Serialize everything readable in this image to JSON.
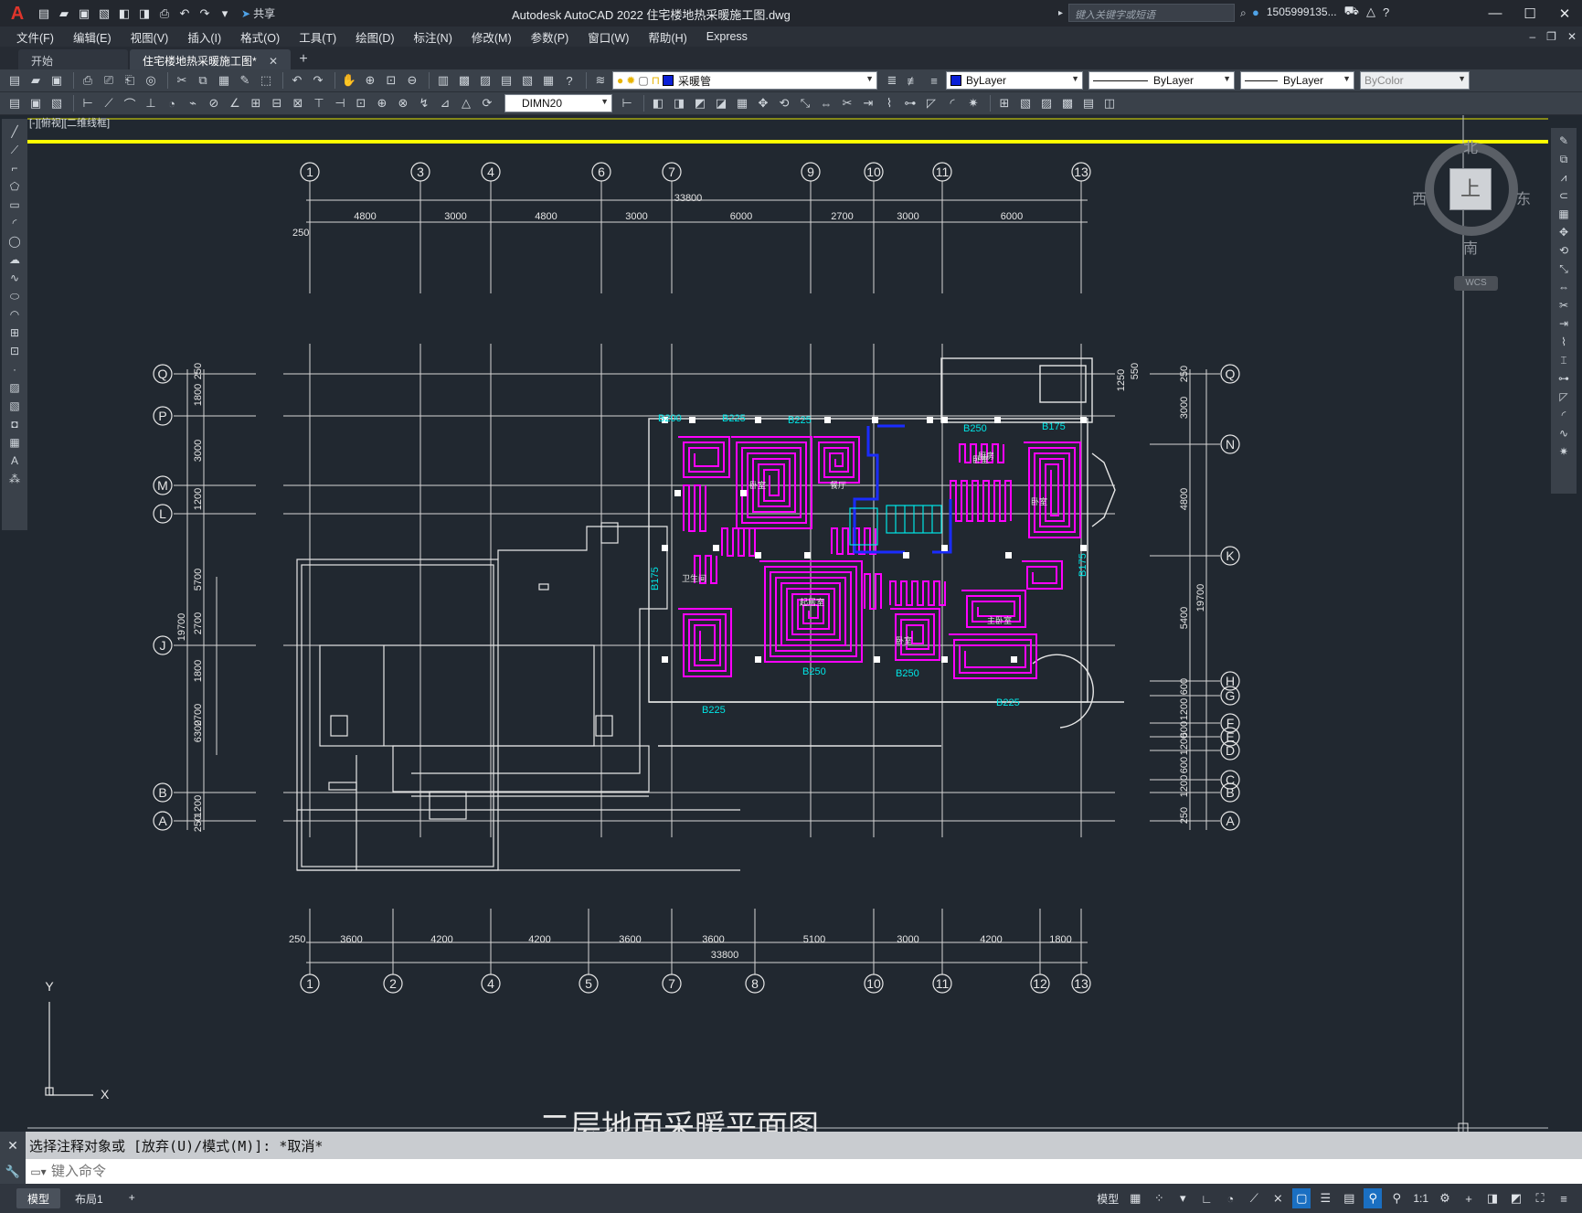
{
  "titlebar": {
    "app_title": "Autodesk AutoCAD 2022    住宅楼地热采暖施工图.dwg",
    "share_label": "共享",
    "search_placeholder": "键入关键字或短语",
    "user_label": "1505999135...",
    "minimize": "—",
    "restore": "☐",
    "close": "✕"
  },
  "menubar": {
    "items": [
      "文件(F)",
      "编辑(E)",
      "视图(V)",
      "插入(I)",
      "格式(O)",
      "工具(T)",
      "绘图(D)",
      "标注(N)",
      "修改(M)",
      "参数(P)",
      "窗口(W)",
      "帮助(H)",
      "Express"
    ]
  },
  "tabs": {
    "start": "开始",
    "active": "住宅楼地热采暖施工图*"
  },
  "toolbar": {
    "layer_name": "采暖管",
    "color_value": "ByLayer",
    "linetype_value": "ByLayer",
    "lineweight_value": "ByLayer",
    "plotstyle_value": "ByColor",
    "dimstyle_value": "DIMN20",
    "layer_color": "#0a1fd6"
  },
  "viewport": {
    "label": "[-][俯视][二维线框]"
  },
  "viewcube": {
    "north": "北",
    "south": "南",
    "west": "西",
    "east": "东",
    "face": "上",
    "wcs": "WCS"
  },
  "drawing": {
    "top_axis_labels": [
      "1",
      "3",
      "4",
      "6",
      "7",
      "9",
      "10",
      "11",
      "13"
    ],
    "top_dims": [
      "4800",
      "3000",
      "4800",
      "3000",
      "6000",
      "2700",
      "3000",
      "6000"
    ],
    "top_total": "33800",
    "top_offset": "250",
    "bottom_axis_labels": [
      "1",
      "2",
      "4",
      "5",
      "7",
      "8",
      "10",
      "11",
      "12",
      "13"
    ],
    "bottom_dims": [
      "3600",
      "4200",
      "4200",
      "3600",
      "3600",
      "5100",
      "3000",
      "4200",
      "1800"
    ],
    "bottom_total": "33800",
    "bottom_offset": "250",
    "left_axis_labels": [
      "Q",
      "P",
      "M",
      "L",
      "J",
      "B",
      "A"
    ],
    "right_axis_labels": [
      "Q",
      "N",
      "K",
      "H",
      "G",
      "F",
      "E",
      "D",
      "C",
      "B",
      "A"
    ],
    "left_dims": [
      "250",
      "1800",
      "3000",
      "1200",
      "5700",
      "2700",
      "1800",
      "2700",
      "6300",
      "1200",
      "250"
    ],
    "left_total": "19700",
    "right_dims": [
      "250",
      "3000",
      "4800",
      "5400",
      "600",
      "1200",
      "600",
      "1200",
      "600",
      "1200",
      "250"
    ],
    "right_total": "19700",
    "right_top_dims": [
      "1250",
      "550"
    ],
    "pipe_labels": [
      "B200",
      "B225",
      "B225",
      "B250",
      "B175",
      "B175",
      "B175",
      "B250",
      "B250",
      "B225",
      "B225"
    ],
    "room_labels": [
      "起居室",
      "卧室",
      "卧室",
      "卧室",
      "餐厅",
      "厨房",
      "卫生间",
      "卧室",
      "主卧室"
    ],
    "coord_x": "X",
    "coord_y": "Y",
    "bottom_title": "二层地面采暖平面图"
  },
  "command": {
    "history": "选择注释对象或 [放弃(U)/模式(M)]: *取消*",
    "input_placeholder": "键入命令"
  },
  "statusbar": {
    "tab_model": "模型",
    "tab_layout": "布局1",
    "model_label": "模型",
    "scale_label": "1:1"
  }
}
